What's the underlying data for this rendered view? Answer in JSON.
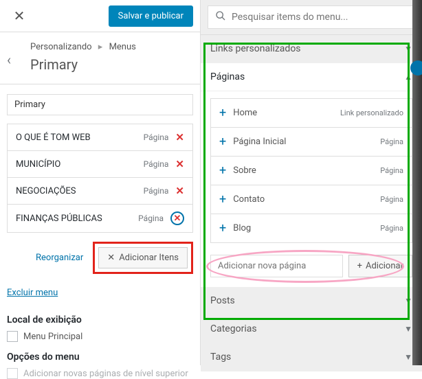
{
  "topbar": {
    "save_label": "Salvar e publicar"
  },
  "breadcrumbs": {
    "root": "Personalizando",
    "section": "Menus"
  },
  "title": "Primary",
  "menu_name_value": "Primary",
  "menu_items": [
    {
      "title": "O QUE É TOM WEB",
      "type": "Página"
    },
    {
      "title": "MUNICÍPIO",
      "type": "Página"
    },
    {
      "title": "NEGOCIAÇÕES",
      "type": "Página"
    },
    {
      "title": "FINANÇAS PÚBLICAS",
      "type": "Página"
    }
  ],
  "reorganize_label": "Reorganizar",
  "add_items_label": "Adicionar Itens",
  "exclude_menu_label": "Excluir menu",
  "display_section_label": "Local de exibição",
  "display_option_label": "Menu Principal",
  "options_section_label": "Opções do menu",
  "options_note": "Adicionar novas páginas de nível superior",
  "search": {
    "placeholder": "Pesquisar items do menu..."
  },
  "accordion": {
    "links": "Links personalizados",
    "pages": "Páginas",
    "posts": "Posts",
    "categories": "Categorias",
    "tags": "Tags"
  },
  "available_pages": [
    {
      "title": "Home",
      "type": "Link personalizado"
    },
    {
      "title": "Página Inicial",
      "type": "Página"
    },
    {
      "title": "Sobre",
      "type": "Página"
    },
    {
      "title": "Contato",
      "type": "Página"
    },
    {
      "title": "Blog",
      "type": "Página"
    }
  ],
  "add_new": {
    "placeholder": "Adicionar nova página",
    "button": "Adicionar"
  }
}
